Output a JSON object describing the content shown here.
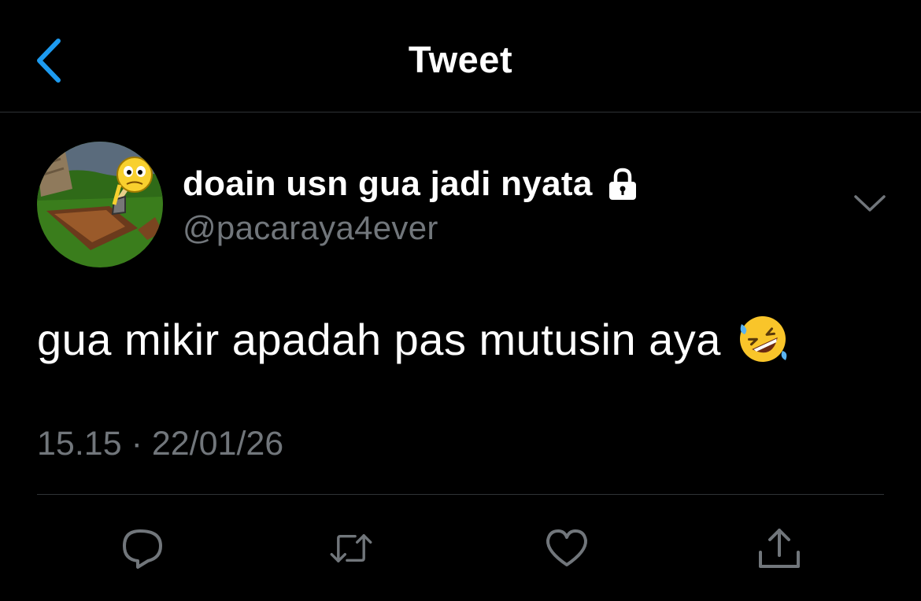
{
  "header": {
    "title": "Tweet",
    "back_icon": "chevron-left-icon"
  },
  "tweet": {
    "display_name": "doain usn gua jadi nyata",
    "protected_icon": "lock-icon",
    "handle": "@pacaraya4ever",
    "text": "gua mikir apadah pas mutusin aya",
    "emoji_icon": "rolling-on-floor-laughing-emoji",
    "time": "15.15",
    "separator": "·",
    "date": "22/01/26"
  },
  "actions": [
    "reply-icon",
    "retweet-icon",
    "like-icon",
    "share-icon"
  ],
  "colors": {
    "background": "#000000",
    "text": "#ffffff",
    "secondary": "#71767b",
    "accent": "#1d9bf0",
    "divider": "#2f3336"
  }
}
